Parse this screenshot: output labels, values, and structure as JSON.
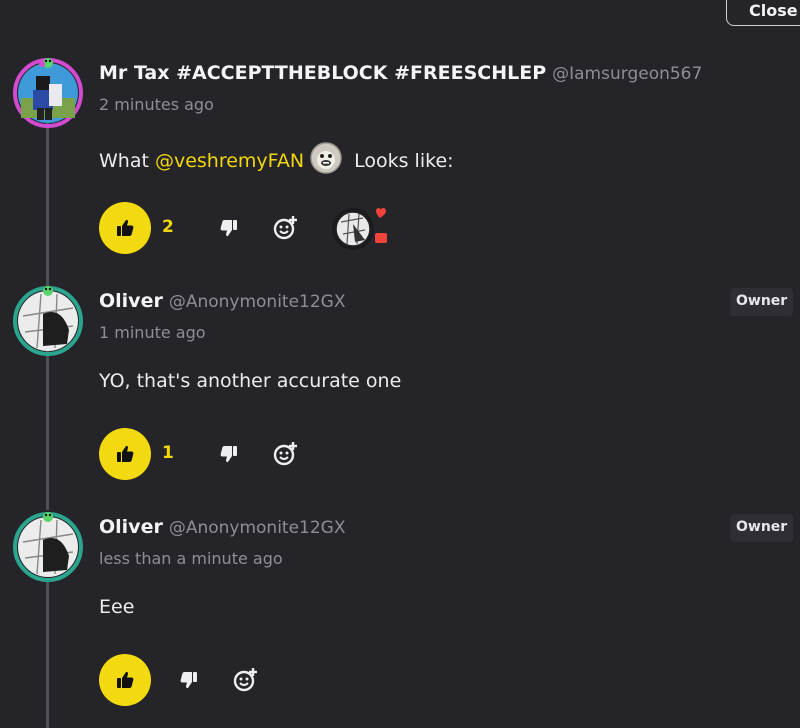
{
  "header": {
    "close_label": "Close"
  },
  "colors": {
    "accent": "#f3d90f",
    "background": "#242429",
    "muted": "#8e8e96",
    "heart": "#f0443a",
    "bubble": "#f0443a"
  },
  "icons": {
    "like": "thumbs-up-icon",
    "dislike": "thumbs-down-icon",
    "react": "add-reaction-icon",
    "reaction_heart": "heart-icon",
    "reaction_comment": "speech-bubble-icon"
  },
  "comments": [
    {
      "name": "Mr Tax #ACCEPTTHEBLOCK #FREESCHLEP",
      "handle": "@Iamsurgeon567",
      "time": "2 minutes ago",
      "text_before": "What ",
      "mention": "@veshremyFAN",
      "text_after": " Looks like:",
      "likes": "2",
      "badge": ""
    },
    {
      "name": "Oliver",
      "handle": "@Anonymonite12GX",
      "time": "1 minute ago",
      "text": "YO, that's another accurate one",
      "likes": "1",
      "badge": "Owner"
    },
    {
      "name": "Oliver",
      "handle": "@Anonymonite12GX",
      "time": "less than a minute ago",
      "text": "Eee",
      "likes": "",
      "badge": "Owner"
    }
  ]
}
